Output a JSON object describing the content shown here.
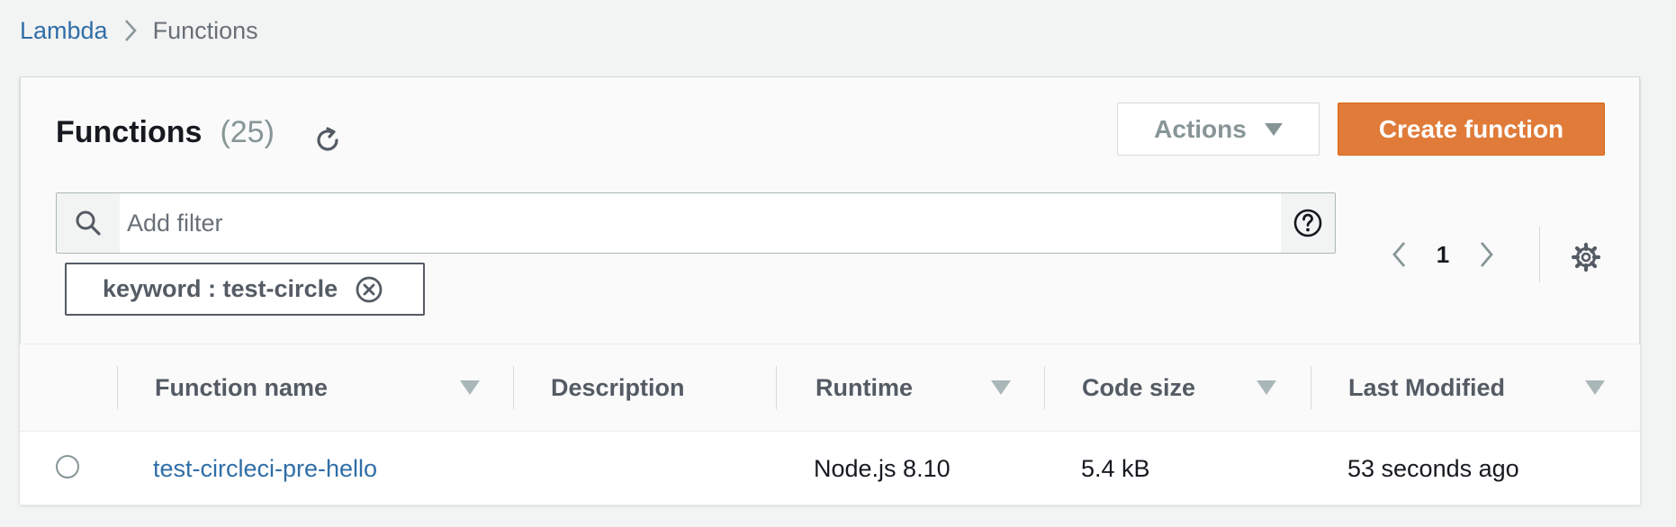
{
  "breadcrumb": {
    "root": "Lambda",
    "current": "Functions"
  },
  "header": {
    "title": "Functions",
    "count": "(25)",
    "actions_label": "Actions",
    "create_label": "Create function"
  },
  "filter": {
    "placeholder": "Add filter",
    "token_label": "keyword : test-circle"
  },
  "pagination": {
    "current_page": "1"
  },
  "table": {
    "columns": [
      "Function name",
      "Description",
      "Runtime",
      "Code size",
      "Last Modified"
    ],
    "rows": [
      {
        "name": "test-circleci-pre-hello",
        "description": "",
        "runtime": "Node.js 8.10",
        "code_size": "5.4 kB",
        "last_modified": "53 seconds ago"
      }
    ]
  },
  "colors": {
    "link": "#2f6ea7",
    "primary_button": "#e07b39",
    "page_background": "#f2f3f3"
  },
  "icons": {
    "breadcrumb_separator": "chevron-right-icon",
    "refresh": "refresh-icon",
    "actions_caret": "caret-down-icon",
    "search": "search-icon",
    "help": "help-circle-icon",
    "token_remove": "close-circle-icon",
    "previous_page": "chevron-left-icon",
    "next_page": "chevron-right-icon",
    "settings": "gear-icon",
    "sort": "caret-down-icon"
  }
}
